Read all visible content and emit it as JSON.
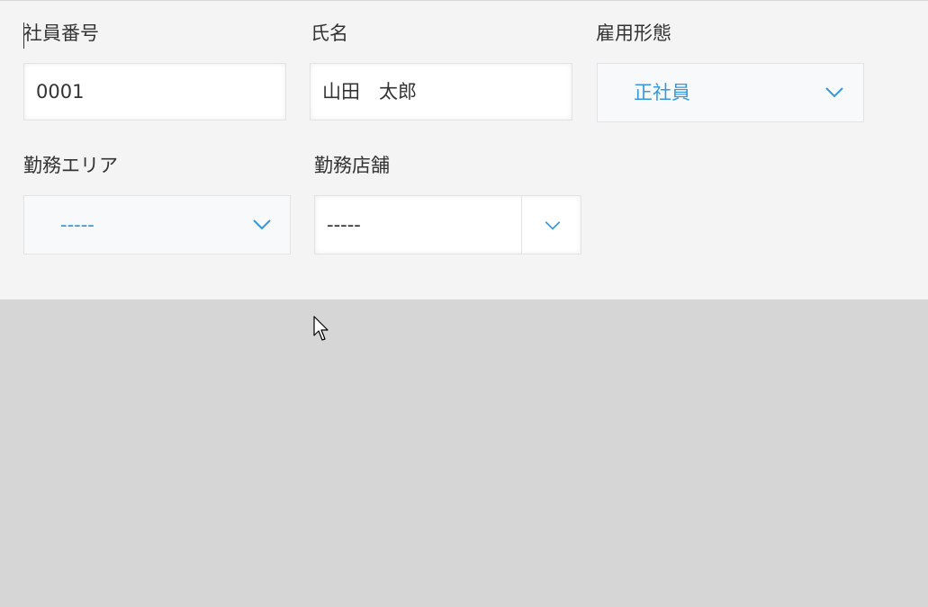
{
  "form": {
    "employee_id": {
      "label": "社員番号",
      "value": "0001"
    },
    "name": {
      "label": "氏名",
      "value": "山田　太郎"
    },
    "employment_type": {
      "label": "雇用形態",
      "value": "正社員"
    },
    "work_area": {
      "label": "勤務エリア",
      "value": "-----"
    },
    "work_store": {
      "label": "勤務店舗",
      "value": "-----"
    }
  },
  "icons": {
    "dropdown": "chevron-down-icon",
    "cursor": "mouse-pointer-icon"
  },
  "colors": {
    "panel_bg": "#f4f4f4",
    "page_bg": "#d5d6d5",
    "accent": "#3498db",
    "text": "#333333"
  }
}
